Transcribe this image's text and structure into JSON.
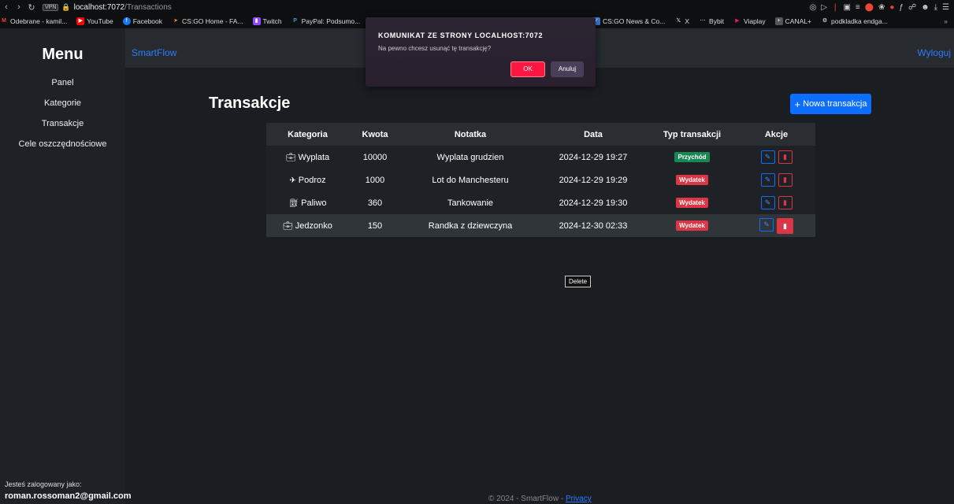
{
  "browser": {
    "url_host": "localhost:7072",
    "url_path": "/Transactions",
    "bookmarks": [
      "Odebrane - kamil...",
      "YouTube",
      "Facebook",
      "CS:GO Home - FA...",
      "Twitch",
      "PayPal: Podsumo..."
    ],
    "bookmarks_right": [
      "CS:GO News & Co...",
      "X",
      "Bybit",
      "Viaplay",
      "CANAL+",
      "podkladka endga..."
    ]
  },
  "sidebar": {
    "title": "Menu",
    "items": [
      {
        "label": "Panel"
      },
      {
        "label": "Kategorie"
      },
      {
        "label": "Transakcje"
      },
      {
        "label": "Cele oszczędnościowe"
      }
    ],
    "logged_label": "Jesteś zalogowany jako:",
    "logged_user": "roman.rossoman2@gmail.com"
  },
  "topbar": {
    "brand": "SmartFlow",
    "logout": "Wyloguj"
  },
  "main": {
    "title": "Transakcje",
    "new_button": "Nowa transakcja",
    "columns": [
      "Kategoria",
      "Kwota",
      "Notatka",
      "Data",
      "Typ transakcji",
      "Akcje"
    ],
    "rows": [
      {
        "category": "Wyplata",
        "icon": "briefcase-icon",
        "amount": "10000",
        "note": "Wyplata grudzien",
        "date": "2024-12-29 19:27",
        "type": "Przychód",
        "type_color": "#198754"
      },
      {
        "category": "Podroz",
        "icon": "plane-icon",
        "amount": "1000",
        "note": "Lot do Manchesteru",
        "date": "2024-12-29 19:29",
        "type": "Wydatek",
        "type_color": "#dc3545"
      },
      {
        "category": "Paliwo",
        "icon": "gas-station-icon",
        "amount": "360",
        "note": "Tankowanie",
        "date": "2024-12-29 19:30",
        "type": "Wydatek",
        "type_color": "#dc3545"
      },
      {
        "category": "Jedzonko",
        "icon": "briefcase-icon",
        "amount": "150",
        "note": "Randka z dziewczyna",
        "date": "2024-12-30 02:33",
        "type": "Wydatek",
        "type_color": "#dc3545"
      }
    ],
    "tooltip": "Delete"
  },
  "footer": {
    "text": "© 2024 - SmartFlow - ",
    "link": "Privacy"
  },
  "dialog": {
    "title": "KOMUNIKAT ZE STRONY LOCALHOST:7072",
    "message": "Na pewno chcesz usunąć tę transakcję?",
    "ok": "OK",
    "cancel": "Anuluj"
  },
  "colors": {
    "accent": "#0d6efd",
    "danger": "#dc3545",
    "success": "#198754",
    "dialog_ok": "#ff1744"
  }
}
